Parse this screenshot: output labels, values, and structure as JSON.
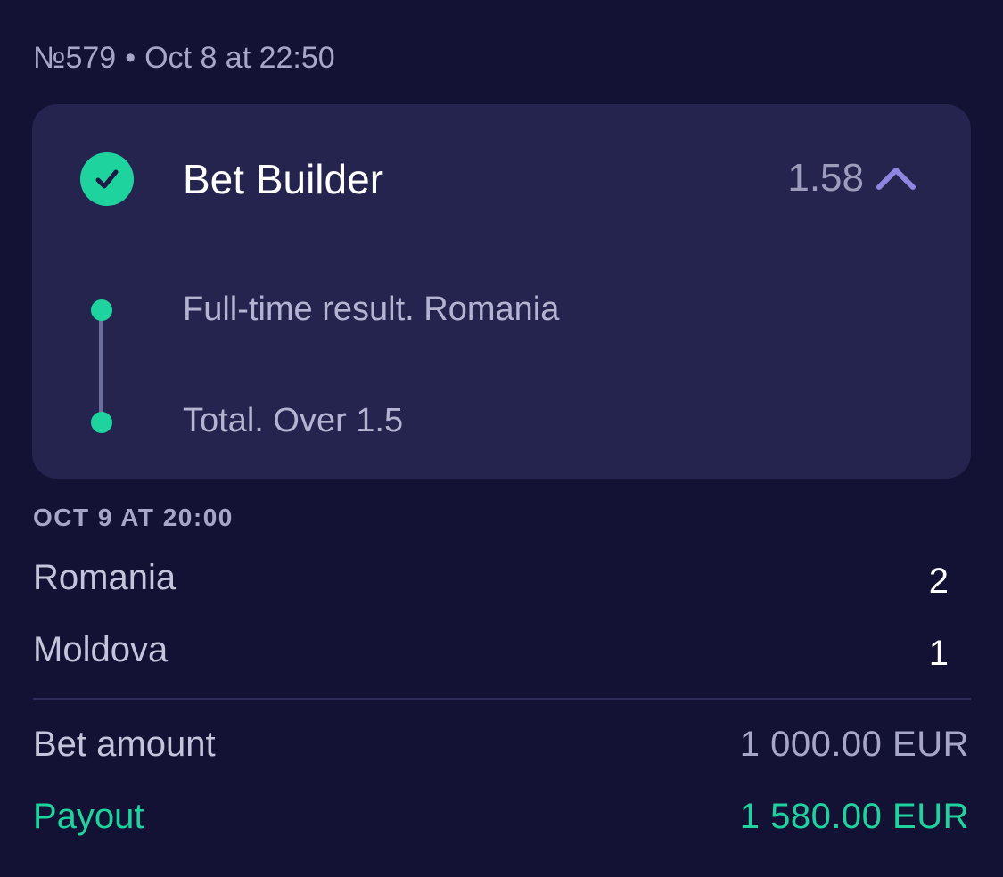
{
  "header": {
    "bet_number": "№579",
    "separator": "•",
    "placed_at": "Oct 8 at 22:50"
  },
  "bet": {
    "status_icon": "check-circle-icon",
    "title": "Bet Builder",
    "odds": "1.58",
    "toggle_icon": "chevron-up-icon",
    "selections": [
      {
        "label": "Full-time result. Romania"
      },
      {
        "label": "Total. Over 1.5"
      }
    ]
  },
  "event": {
    "date": "OCT 9 AT 20:00",
    "teams": [
      {
        "name": "Romania",
        "score": "2"
      },
      {
        "name": "Moldova",
        "score": "1"
      }
    ]
  },
  "summary": {
    "bet_amount_label": "Bet amount",
    "bet_amount_value": "1 000.00 EUR",
    "payout_label": "Payout",
    "payout_value": "1 580.00 EUR"
  },
  "colors": {
    "background": "#131235",
    "card": "#24244f",
    "accent_green": "#1fd39f",
    "chevron": "#8f86e0"
  }
}
